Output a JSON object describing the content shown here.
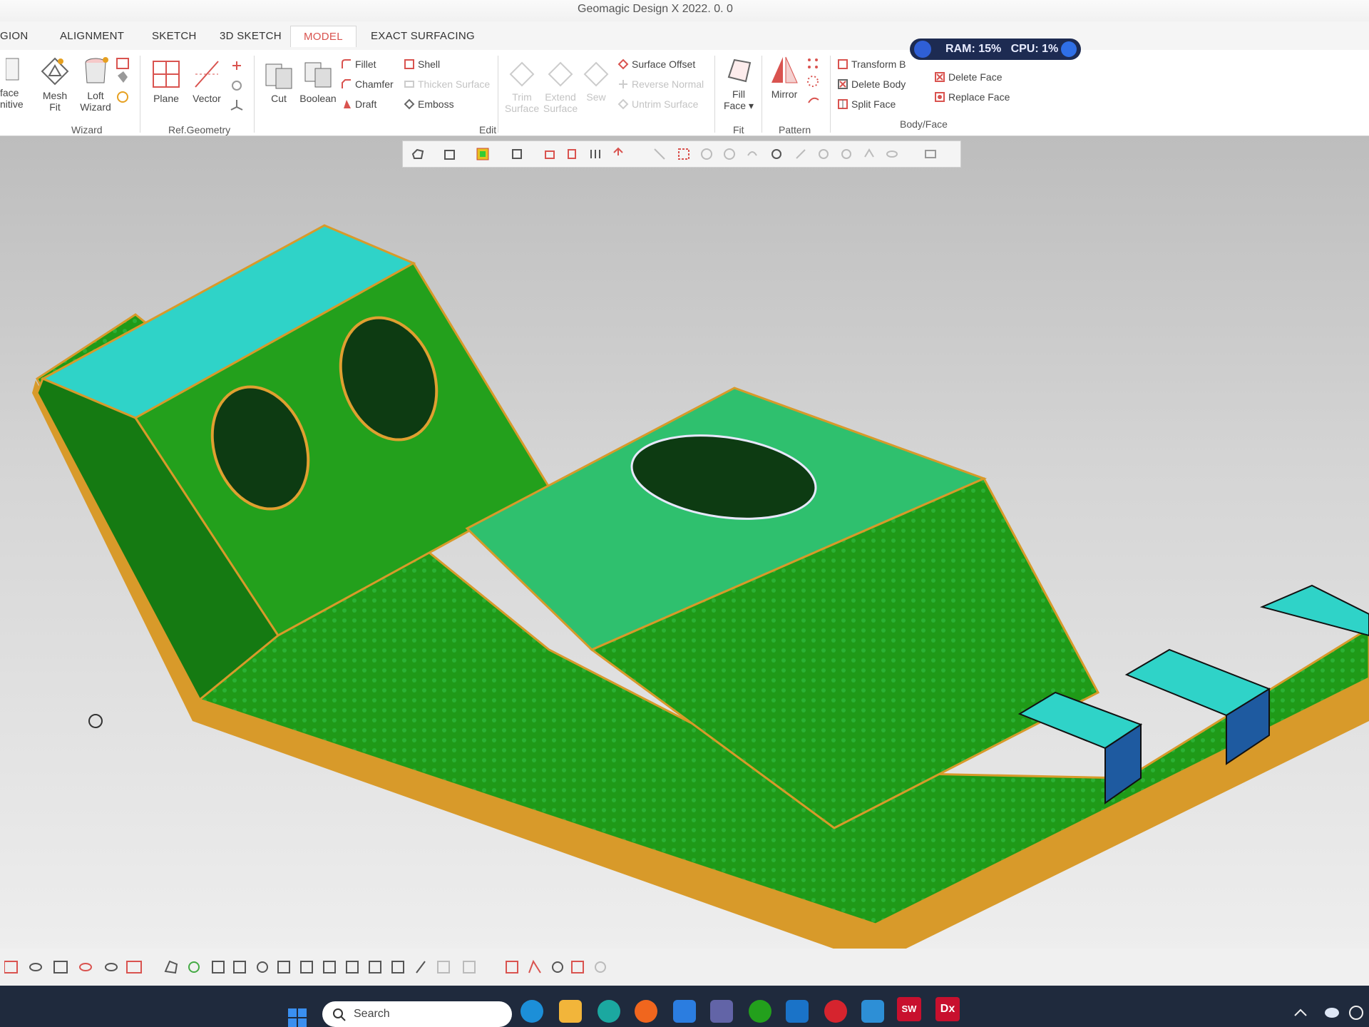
{
  "window": {
    "title": "Geomagic Design X 2022. 0. 0"
  },
  "tabs": [
    {
      "label": "GION"
    },
    {
      "label": "ALIGNMENT"
    },
    {
      "label": "SKETCH"
    },
    {
      "label": "3D SKETCH"
    },
    {
      "label": "MODEL"
    },
    {
      "label": "EXACT SURFACING"
    }
  ],
  "active_tab": "MODEL",
  "ribbon": {
    "wizard": {
      "group": "Wizard",
      "surface_primitive_a": "face",
      "surface_primitive_b": "nitive",
      "mesh_fit_a": "Mesh",
      "mesh_fit_b": "Fit",
      "loft_wizard_a": "Loft",
      "loft_wizard_b": "Wizard"
    },
    "ref_geometry": {
      "group": "Ref.Geometry",
      "plane": "Plane",
      "vector": "Vector"
    },
    "edit": {
      "group": "Edit",
      "cut": "Cut",
      "boolean": "Boolean",
      "fillet": "Fillet",
      "chamfer": "Chamfer",
      "draft": "Draft",
      "shell": "Shell",
      "thicken_surface": "Thicken Surface",
      "emboss": "Emboss",
      "trim_surface_a": "Trim",
      "trim_surface_b": "Surface",
      "extend_surface_a": "Extend",
      "extend_surface_b": "Surface",
      "sew": "Sew",
      "surface_offset": "Surface Offset",
      "reverse_normal": "Reverse Normal",
      "untrim_surface": "Untrim Surface"
    },
    "fit": {
      "group": "Fit",
      "fill_face_a": "Fill",
      "fill_face_b": "Face"
    },
    "pattern": {
      "group": "Pattern",
      "mirror": "Mirror"
    },
    "body_face": {
      "group": "Body/Face",
      "transform_body": "Transform B",
      "delete_body": "Delete Body",
      "split_face": "Split Face",
      "delete_face": "Delete Face",
      "replace_face": "Replace Face"
    }
  },
  "perf_monitor": {
    "ram": "RAM: 15%",
    "cpu": "CPU: 1%"
  },
  "taskbar": {
    "search_placeholder": "Search",
    "solidworks_label": "SW",
    "dx_label": "Dx"
  },
  "colors": {
    "model_green": "#23a01c",
    "model_dark_green": "#157a12",
    "deviation_cyan": "#2fd3c8",
    "edge_orange": "#d89a2a",
    "accent_red": "#d9534f"
  }
}
